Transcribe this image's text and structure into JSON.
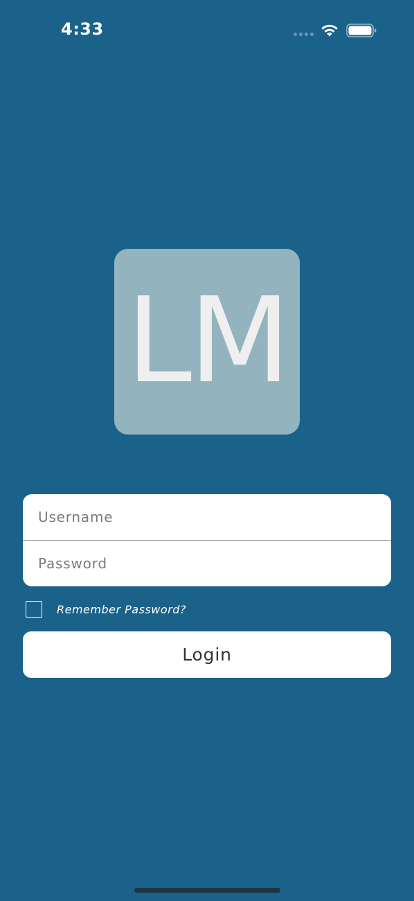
{
  "status_bar": {
    "time": "4:33",
    "icons": [
      "signal-dots-icon",
      "wifi-icon",
      "battery-icon"
    ]
  },
  "logo": {
    "text": "LM",
    "background": "#93b3bf",
    "text_color": "#efefef"
  },
  "login_form": {
    "username_placeholder": "Username",
    "username_value": "",
    "password_placeholder": "Password",
    "password_value": "",
    "remember_label": "Remember Password?",
    "remember_checked": false,
    "login_label": "Login"
  },
  "colors": {
    "background": "#1a628a",
    "field_background": "#ffffff",
    "button_text": "#333333"
  }
}
